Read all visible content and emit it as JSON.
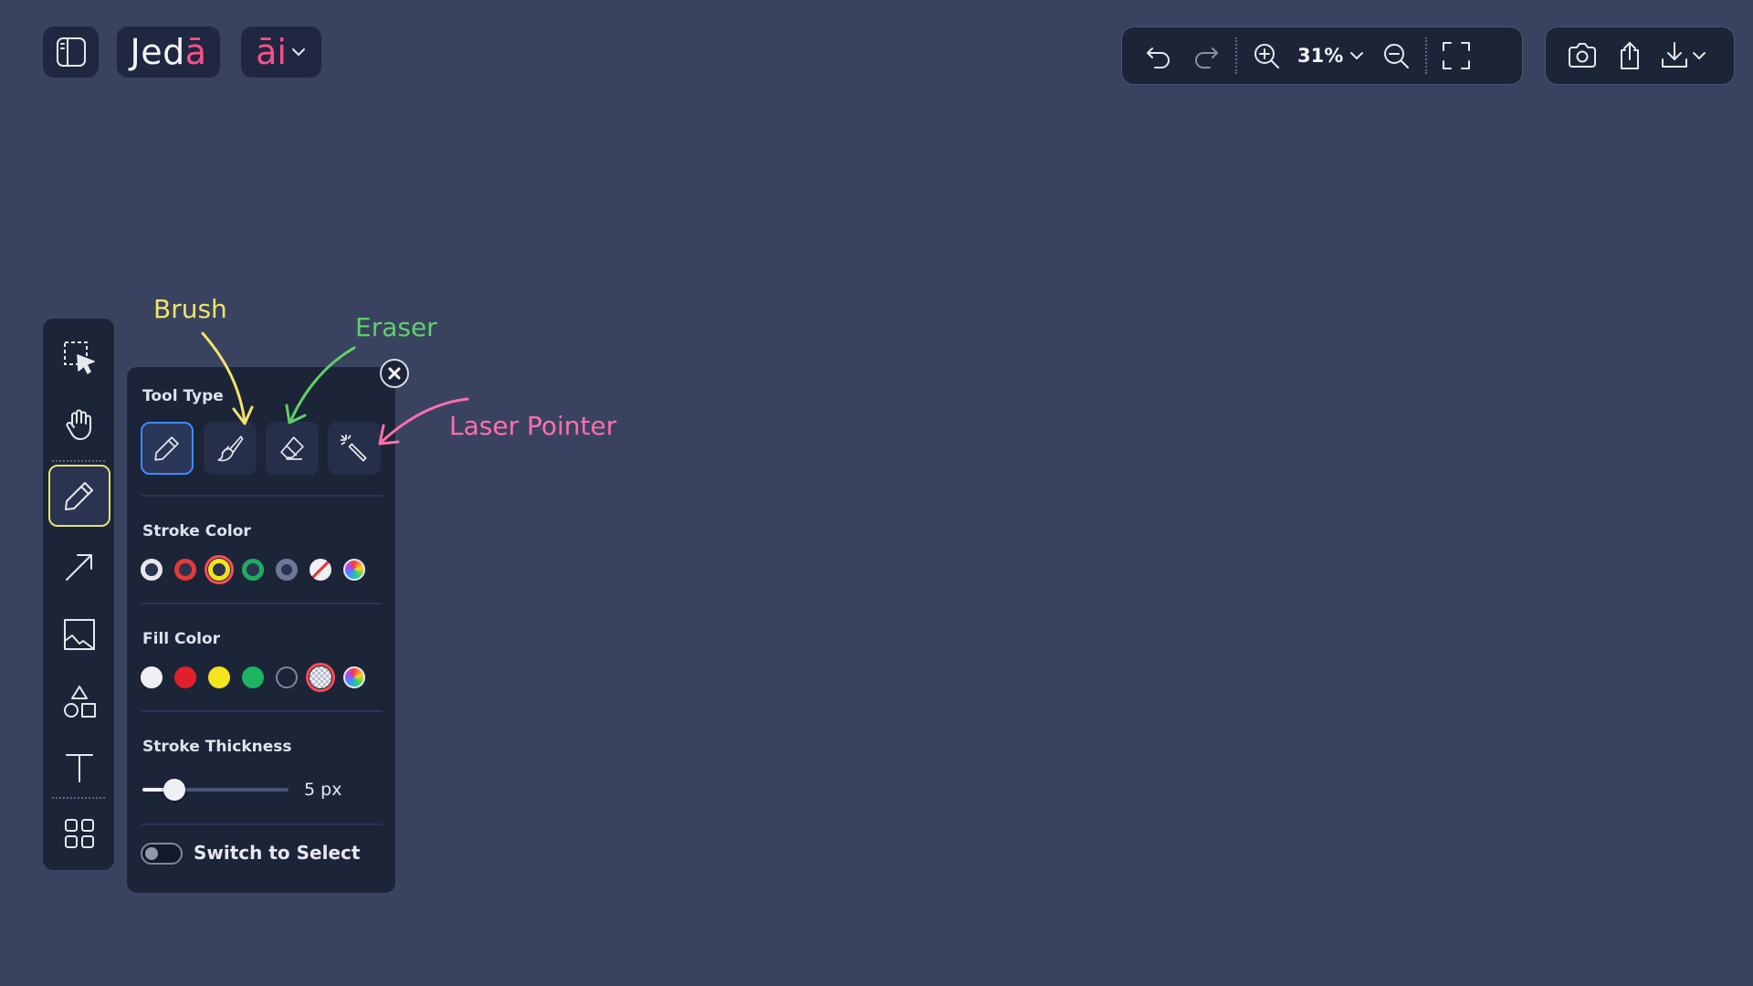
{
  "brand": {
    "name_main": "Jed",
    "name_accent": "ā"
  },
  "ai_menu": {
    "label": "āi"
  },
  "view_toolbar": {
    "zoom": "31%"
  },
  "tool_panel": {
    "tool_type_title": "Tool Type",
    "tool_types": [
      {
        "icon": "pencil-icon",
        "active": true
      },
      {
        "icon": "brush-icon",
        "active": false
      },
      {
        "icon": "eraser-icon",
        "active": false
      },
      {
        "icon": "laser-pointer-icon",
        "active": false
      }
    ],
    "stroke_color_title": "Stroke Color",
    "stroke_colors": [
      "#e5e7ec",
      "#e53935",
      "#f2e21c",
      "#1faa62",
      "#2a3350",
      "transparent",
      "multicolor"
    ],
    "stroke_color_selected_index": 2,
    "fill_color_title": "Fill Color",
    "fill_colors": [
      "#eef0f4",
      "#e0202a",
      "#f4e51f",
      "#1db460",
      "#1c2438",
      "transparent",
      "multicolor"
    ],
    "fill_color_selected_index": 5,
    "stroke_thickness_title": "Stroke Thickness",
    "stroke_thickness": {
      "value": 5,
      "min": 1,
      "max": 50
    },
    "stroke_thickness_value": "5 px",
    "switch_to_select_label": "Switch to Select",
    "switch_to_select_on": false
  },
  "annotations": {
    "brush": "Brush",
    "eraser": "Eraser",
    "laser": "Laser Pointer",
    "brush_color": "#f1e46b",
    "eraser_color": "#62cf6a",
    "laser_color": "#ff6fae"
  }
}
